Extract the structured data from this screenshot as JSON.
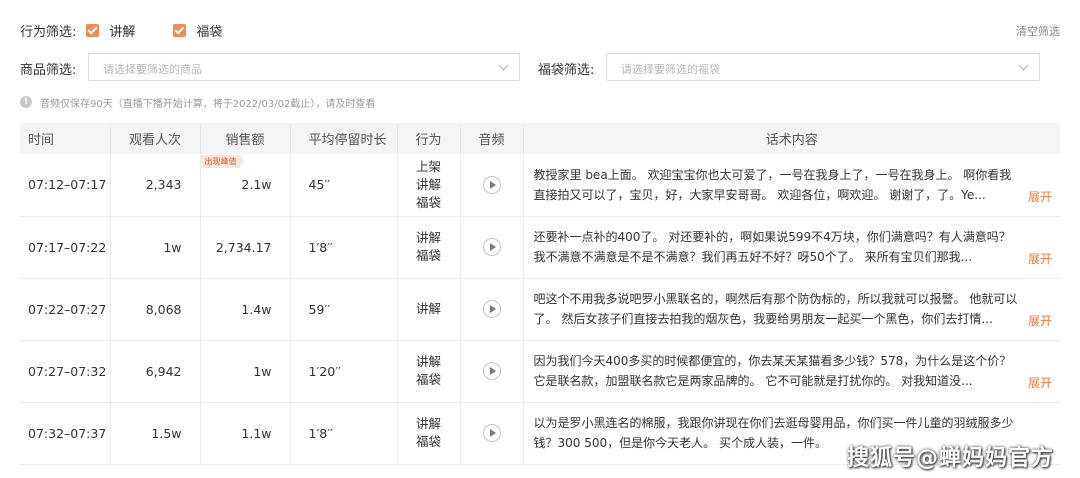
{
  "filters": {
    "behavior_label": "行为筛选:",
    "behavior_options": [
      "讲解",
      "福袋"
    ],
    "clear_label": "清空筛选",
    "product_label": "商品筛选:",
    "product_placeholder": "请选择要筛选的商品",
    "bag_label": "福袋筛选:",
    "bag_placeholder": "请选择要筛选的福袋"
  },
  "notice": "音频仅保存90天（直播下播开始计算，将于2022/03/02截止），请及时查看",
  "table": {
    "headers": [
      "时间",
      "观看人次",
      "销售额",
      "平均停留时长",
      "行为",
      "音频",
      "话术内容"
    ],
    "peak_badge": "出现峰值",
    "expand_label": "展开",
    "rows": [
      {
        "time": "07:12–07:17",
        "views": "2,343",
        "sales": "2.1w",
        "dwell": "45′′",
        "actions": [
          "上架",
          "讲解",
          "福袋"
        ],
        "script": "教授家里 bea上面。 欢迎宝宝你也太可爱了，一号在我身上了，一号在我身上。 啊你看我直接拍又可以了，宝贝，好，大家早安哥哥。 欢迎各位，啊欢迎。 谢谢了，了。Ye..."
      },
      {
        "time": "07:17–07:22",
        "views": "1w",
        "sales": "2,734.17",
        "dwell": "1′8′′",
        "actions": [
          "讲解",
          "福袋"
        ],
        "script": "还要补一点补的400了。 对还要补的，啊如果说599不4万块，你们满意吗？有人满意吗？我不满意不满意是不是不满意？我们再五好不好？呀50个了。 来所有宝贝们那我..."
      },
      {
        "time": "07:22–07:27",
        "views": "8,068",
        "sales": "1.4w",
        "dwell": "59′′",
        "actions": [
          "讲解"
        ],
        "script": "吧这个不用我多说吧罗小黑联名的，啊然后有那个防伪标的，所以我就可以报警。 他就可以了。 然后女孩子们直接去拍我的烟灰色，我要给男朋友一起买一个黑色，你们去打情..."
      },
      {
        "time": "07:27–07:32",
        "views": "6,942",
        "sales": "1w",
        "dwell": "1′20′′",
        "actions": [
          "讲解",
          "福袋"
        ],
        "script": "因为我们今天400多买的时候都便宜的，你去某天某猫看多少钱？578，为什么是这个价？它是联名款，加盟联名款它是两家品牌的。 它不可能就是打扰你的。 对我知道没..."
      },
      {
        "time": "07:32–07:37",
        "views": "1.5w",
        "sales": "1.1w",
        "dwell": "1′8′′",
        "actions": [
          "讲解",
          "福袋"
        ],
        "script": "以为是罗小黑连名的棉服，我跟你讲现在你们去逛母婴用品，你们买一件儿童的羽绒服多少钱？300 500，但是你今天老人。 买个成人装，一件。"
      }
    ]
  },
  "watermark": "搜狐号@蝉妈妈官方",
  "colors": {
    "accent": "#ee7a45",
    "checkbox": "#ec8c5a",
    "header_bg": "#f4f5f7"
  }
}
